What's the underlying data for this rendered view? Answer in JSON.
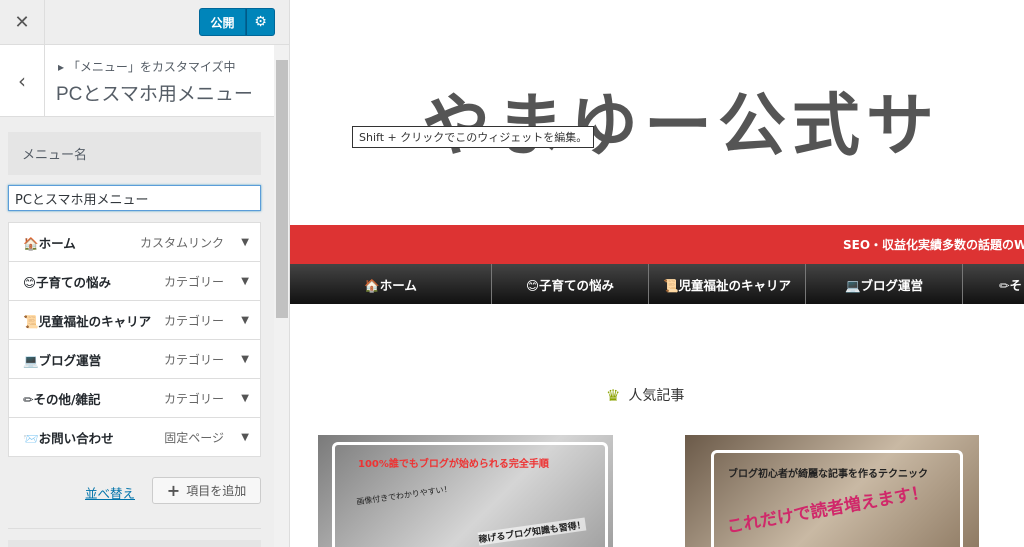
{
  "customizer": {
    "close_glyph": "✕",
    "publish_label": "公開",
    "gear_glyph": "⚙",
    "back_glyph": "‹",
    "breadcrumb": "「メニュー」をカスタマイズ中",
    "breadcrumb_arrow": "▸",
    "section_title": "PCとスマホ用メニュー",
    "menu_name_label": "メニュー名",
    "menu_name_value": "PCとスマホ用メニュー",
    "items": [
      {
        "label": "🏠ホーム",
        "type": "カスタムリンク"
      },
      {
        "label": "😊子育ての悩み",
        "type": "カテゴリー"
      },
      {
        "label": "📜児童福祉のキャリア",
        "type": "カテゴリー"
      },
      {
        "label": "💻ブログ運営",
        "type": "カテゴリー"
      },
      {
        "label": "✏その他/雑記",
        "type": "カテゴリー"
      },
      {
        "label": "📨お問い合わせ",
        "type": "固定ページ"
      }
    ],
    "reorder_label": "並べ替え",
    "add_item_label": "項目を追加",
    "add_item_glyph": "+"
  },
  "preview": {
    "site_title": "やまゆー公式サ",
    "tooltip": "Shift + クリックでこのウィジェットを編集。",
    "tagline": "SEO・収益化実績多数の話題のW",
    "nav": [
      "🏠ホーム",
      "😊子育ての悩み",
      "📜児童福祉のキャリア",
      "💻ブログ運営",
      "✏そ"
    ],
    "popular_heading": "人気記事",
    "crown_glyph": "♛",
    "card1": {
      "headline": "100%誰でもブログが始められる完全手順",
      "note_a": "画像付きでわかりやすい！",
      "note_b": "稼げるブログ知識も習得！"
    },
    "card2": {
      "headline": "ブログ初心者が綺麗な記事を作るテクニック",
      "accent": "これだけで読者増えます！"
    }
  }
}
